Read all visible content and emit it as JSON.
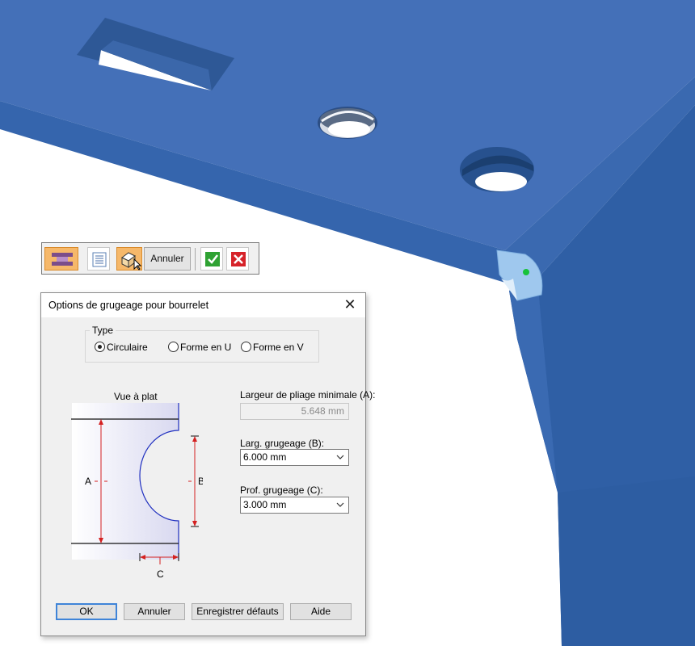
{
  "command_bar": {
    "cancel_label": "Annuler",
    "icons": [
      "sheetmetal-bead-icon",
      "list-icon",
      "select-face-icon",
      "checkmark-icon",
      "cancel-x-icon"
    ]
  },
  "dialog": {
    "title": "Options de grugeage pour bourrelet",
    "type_group": {
      "legend": "Type",
      "options": [
        {
          "label": "Circulaire",
          "selected": true
        },
        {
          "label": "Forme en U",
          "selected": false
        },
        {
          "label": "Forme en V",
          "selected": false
        }
      ]
    },
    "diagram": {
      "title": "Vue à plat",
      "labels": {
        "a": "A",
        "b": "B",
        "c": "C"
      }
    },
    "fields": {
      "min_bend_width": {
        "label": "Largeur de pliage minimale (A):",
        "value": "5.648 mm"
      },
      "relief_width": {
        "label": "Larg. grugeage (B):",
        "value": "6.000 mm"
      },
      "relief_depth": {
        "label": "Prof. grugeage (C):",
        "value": "3.000 mm"
      }
    },
    "buttons": {
      "ok": "OK",
      "cancel": "Annuler",
      "save_defaults": "Enregistrer défauts",
      "help": "Aide"
    }
  },
  "colors": {
    "part_top": "#4470b8",
    "part_side": "#3461a6",
    "dimension_red": "#d42020",
    "command_bar_active": "#f6b86a",
    "ok_focus_border": "#3f84d8"
  }
}
